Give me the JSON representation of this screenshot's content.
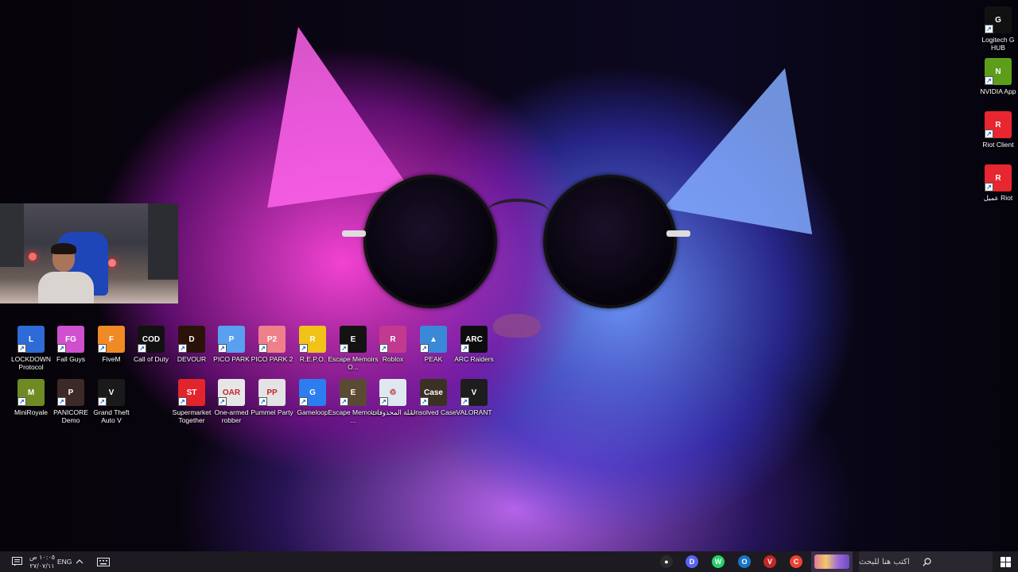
{
  "desktop": {
    "left_icons": [
      {
        "label": "LOCKDOWN Protocol",
        "color": "#2e6bd6",
        "glyph": "L"
      },
      {
        "label": "Fall Guys",
        "color": "#d04fcf",
        "glyph": "FG"
      },
      {
        "label": "FiveM",
        "color": "#f08a24",
        "glyph": "F"
      },
      {
        "label": "Call of Duty",
        "color": "#111111",
        "glyph": "COD"
      },
      {
        "label": "DEVOUR",
        "color": "#2a1208",
        "glyph": "D"
      },
      {
        "label": "PICO PARK",
        "color": "#5aa0f0",
        "glyph": "P"
      },
      {
        "label": "PICO PARK 2",
        "color": "#f07f8c",
        "glyph": "P2"
      },
      {
        "label": "R.E.P.O.",
        "color": "#f0c21a",
        "glyph": "R"
      },
      {
        "label": "Escape Memoirs O...",
        "color": "#141212",
        "glyph": "E"
      },
      {
        "label": "Roblox",
        "color": "#c23a8f",
        "glyph": "R"
      },
      {
        "label": "PEAK",
        "color": "#3a88d8",
        "glyph": "▲"
      },
      {
        "label": "ARC Raiders",
        "color": "#0d0d0d",
        "glyph": "ARC"
      },
      {
        "label": "MiniRoyale",
        "color": "#6f8a22",
        "glyph": "M"
      },
      {
        "label": "PANICORE Demo",
        "color": "#3c2a28",
        "glyph": "P"
      },
      {
        "label": "Grand Theft Auto V",
        "color": "#1a1a1a",
        "glyph": "V"
      },
      {
        "label": "Supermarket Together",
        "color": "#e2242c",
        "glyph": "ST"
      },
      {
        "label": "One-armed robber",
        "color": "#e6e6e6",
        "glyph": "OAR"
      },
      {
        "label": "Pummel Party",
        "color": "#e3e3e3",
        "glyph": "PP"
      },
      {
        "label": "Gameloop",
        "color": "#2c7df0",
        "glyph": "G"
      },
      {
        "label": "Escape Memoirs ...",
        "color": "#5a4a34",
        "glyph": "E"
      },
      {
        "label": "سلة المحذوفات",
        "color": "#dfe8f0",
        "glyph": "♲"
      },
      {
        "label": "Unsolved Case",
        "color": "#3a3024",
        "glyph": "Case"
      },
      {
        "label": "VALORANT",
        "color": "#1d1d1d",
        "glyph": "V"
      }
    ],
    "right_icons": [
      {
        "label": "Logitech G HUB",
        "color": "#111111",
        "glyph": "G"
      },
      {
        "label": "NVIDIA App",
        "color": "#5c9d1a",
        "glyph": "N"
      },
      {
        "label": "Riot Client",
        "color": "#e8262f",
        "glyph": "R"
      },
      {
        "label": "عميل Riot",
        "color": "#e8262f",
        "glyph": "R"
      }
    ]
  },
  "taskbar": {
    "start_icon": "windows-icon",
    "search_placeholder": "اكتب هنا للبحث",
    "search_icon": "search-icon",
    "clock_time": "١٠:٠٥ ص",
    "clock_date": "٢٧/٠٧/١١",
    "language": "ENG",
    "pinned_apps": [
      {
        "name": "obs-icon",
        "color": "#2b2b2b",
        "glyph": "●"
      },
      {
        "name": "discord-icon",
        "color": "#5865f2",
        "glyph": "D"
      },
      {
        "name": "whatsapp-icon",
        "color": "#25d366",
        "glyph": "W"
      },
      {
        "name": "outlook-icon",
        "color": "#1a73c8",
        "glyph": "O"
      },
      {
        "name": "editor-icon",
        "color": "#c42727",
        "glyph": "V"
      },
      {
        "name": "chrome-icon",
        "color": "#e94335",
        "glyph": "C"
      }
    ]
  }
}
